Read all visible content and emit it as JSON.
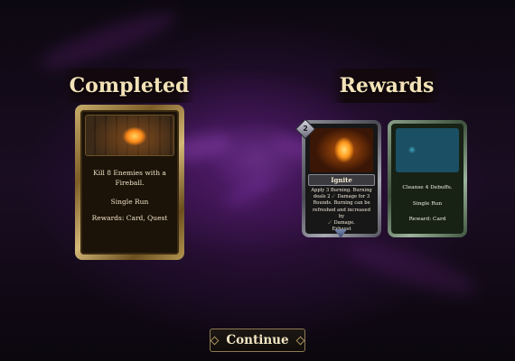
{
  "completed": {
    "heading": "Completed",
    "quest_card": {
      "description": "Kill 8 Enemies with a Fireball.",
      "duration": "Single Run",
      "rewards": "Rewards: Card, Quest"
    }
  },
  "rewards": {
    "heading": "Rewards",
    "cards": [
      {
        "cost": "2",
        "name": "Ignite",
        "description_lines": [
          "Apply 3 Burning. Burning",
          "deals 2 ☄ Damage for 3",
          "Rounds. Burning can be",
          "refreshed and increased by",
          "☄ Damage.",
          "Exhaust"
        ]
      },
      {
        "description": "Cleanse 4 Debuffs.",
        "duration": "Single Run",
        "reward": "Reward: Card"
      }
    ]
  },
  "continue_button": {
    "label": "Continue"
  }
}
